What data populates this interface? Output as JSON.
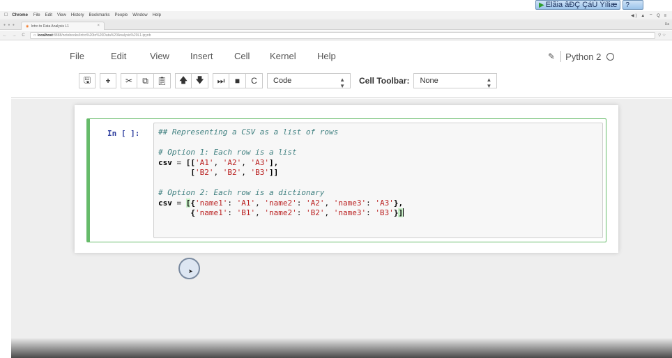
{
  "overlay": {
    "play_label": "Elãia âÐÇ ÇáÙ Ýíliæ",
    "help_label": "?"
  },
  "macbar": {
    "apple": "",
    "app": "Chrome",
    "items": [
      "File",
      "Edit",
      "View",
      "History",
      "Bookmarks",
      "People",
      "Window",
      "Help"
    ]
  },
  "browser": {
    "tab_title": "Intro to Data Analysis L1",
    "tab_close": "×",
    "user": "Ua",
    "url_host": "localhost",
    "url_path": ":8888/notebooks/Intro%20to%20Data%20Analysis%20L1.ipynb"
  },
  "jupyter": {
    "menu": [
      "File",
      "Edit",
      "View",
      "Insert",
      "Cell",
      "Kernel",
      "Help"
    ],
    "kernel_name": "Python 2",
    "cell_type": "Code",
    "cell_toolbar_label": "Cell Toolbar:",
    "cell_toolbar_value": "None"
  },
  "cell": {
    "prompt": "In [ ]:",
    "code": {
      "line1": "## Representing a CSV as a list of rows",
      "line2": "# Option 1: Each row is a list",
      "line5": "# Option 2: Each row is a dictionary"
    }
  },
  "colors": {
    "cell_border": "#66bb6a",
    "prompt": "#303f9f",
    "string": "#ba2121",
    "comment": "#408080"
  }
}
